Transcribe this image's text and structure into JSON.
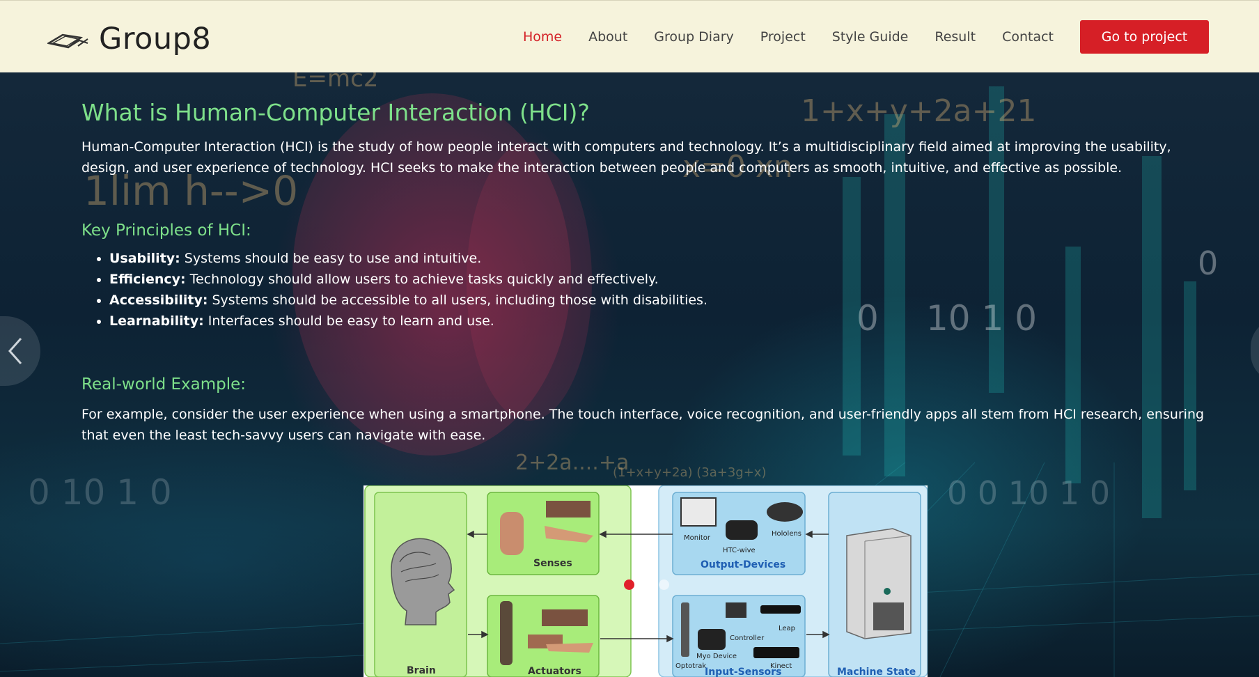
{
  "header": {
    "logo_text": "Group8",
    "nav": [
      "Home",
      "About",
      "Group Diary",
      "Project",
      "Style Guide",
      "Result",
      "Contact"
    ],
    "active_nav": "Home",
    "cta_label": "Go to project",
    "colors": {
      "header_bg": "#f6f3dc",
      "active": "#d42027",
      "cta": "#d61f26"
    }
  },
  "hero": {
    "title": "What is Human-Computer Interaction (HCI)?",
    "intro": "Human-Computer Interaction (HCI) is the study of how people interact with computers and technology. It’s a multidisciplinary field aimed at improving the usability, design, and user experience of technology. HCI seeks to make the interaction between people and computers as smooth, intuitive, and effective as possible.",
    "principles_heading": "Key Principles of HCI:",
    "principles": [
      {
        "term": "Usability:",
        "text": " Systems should be easy to use and intuitive."
      },
      {
        "term": "Efficiency:",
        "text": " Technology should allow users to achieve tasks quickly and effectively."
      },
      {
        "term": "Accessibility:",
        "text": " Systems should be accessible to all users, including those with disabilities."
      },
      {
        "term": "Learnability:",
        "text": " Interfaces should be easy to learn and use."
      }
    ],
    "example_heading": "Real-world Example:",
    "example_text": "For example, consider the user experience when using a smartphone. The touch interface, voice recognition, and user-friendly apps all stem from HCI research, ensuring that even the least tech-savvy users can navigate with ease.",
    "heading_color": "#7ee08a",
    "background_text": [
      "E=mc2",
      "1+x+y+2a+21",
      "1lim h-->0",
      "x=0 xn",
      "0 10 1 0",
      "2+2a....+a"
    ]
  },
  "diagram": {
    "labels": {
      "brain": "Brain",
      "senses": "Senses",
      "actuators": "Actuators",
      "output_devices": "Output-Devices",
      "input_sensors": "Input-Sensors",
      "machine_state": "Machine State",
      "monitor": "Monitor",
      "htc": "HTC-wive",
      "hololens": "Hololens",
      "controller": "Controller",
      "leap": "Leap",
      "myo": "Myo Device",
      "optotrak": "Optotrak",
      "kinect": "Kinect"
    },
    "colors": {
      "human_bg": "#d6f7b8",
      "human_box": "#a8ec7a",
      "machine_bg": "#d4ecf8",
      "machine_box": "#a8d8f0",
      "label_blue": "#1f5fb3"
    }
  },
  "carousel": {
    "slides": 3,
    "active_index": 0
  }
}
